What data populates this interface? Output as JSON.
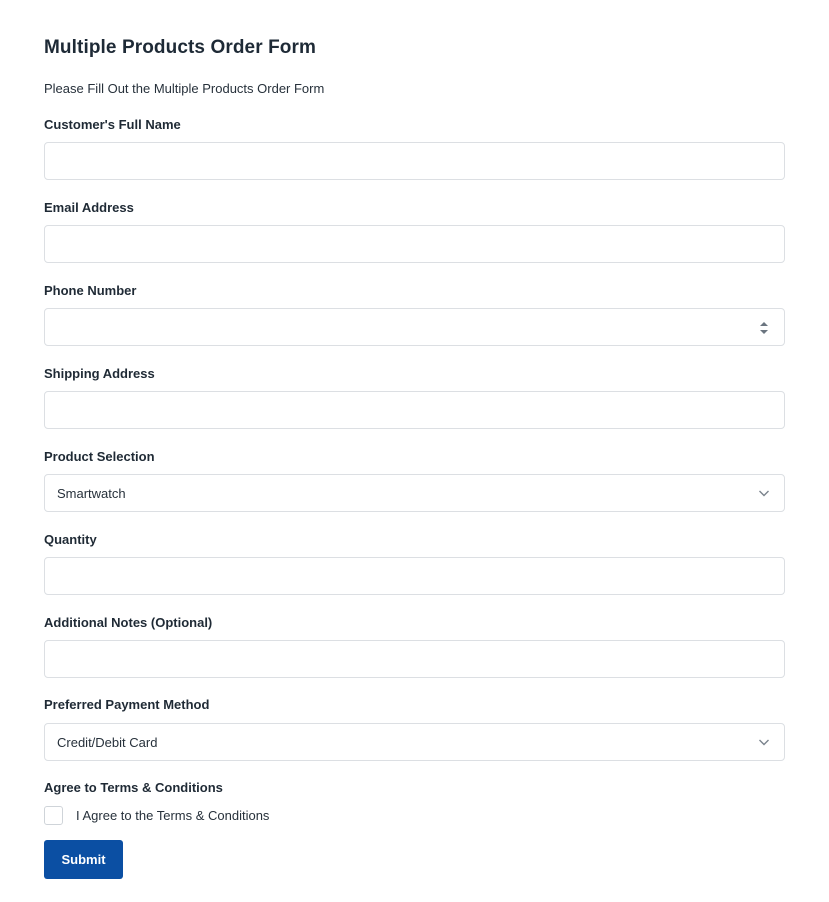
{
  "form": {
    "title": "Multiple Products Order Form",
    "description": "Please Fill Out the Multiple Products Order Form",
    "fields": {
      "full_name": {
        "label": "Customer's Full Name",
        "value": "",
        "placeholder": ""
      },
      "email": {
        "label": "Email Address",
        "value": "",
        "placeholder": ""
      },
      "phone": {
        "label": "Phone Number",
        "value": "",
        "placeholder": ""
      },
      "address": {
        "label": "Shipping Address",
        "value": "",
        "placeholder": ""
      },
      "product": {
        "label": "Product Selection",
        "selected": "Smartwatch"
      },
      "quantity": {
        "label": "Quantity",
        "value": "",
        "placeholder": ""
      },
      "notes": {
        "label": "Additional Notes (Optional)",
        "value": "",
        "placeholder": ""
      },
      "payment": {
        "label": "Preferred Payment Method",
        "selected": "Credit/Debit Card"
      },
      "terms": {
        "label": "Agree to Terms & Conditions",
        "checkbox_label": "I Agree to the Terms & Conditions",
        "checked": false
      }
    },
    "submit_label": "Submit"
  },
  "icons": {
    "select_arrow": "chevron-down-icon",
    "number_spinner": "spinner-arrows-icon"
  },
  "colors": {
    "primary": "#0b4fa3",
    "border": "#dcdfe3",
    "text": "#1f2a35"
  }
}
